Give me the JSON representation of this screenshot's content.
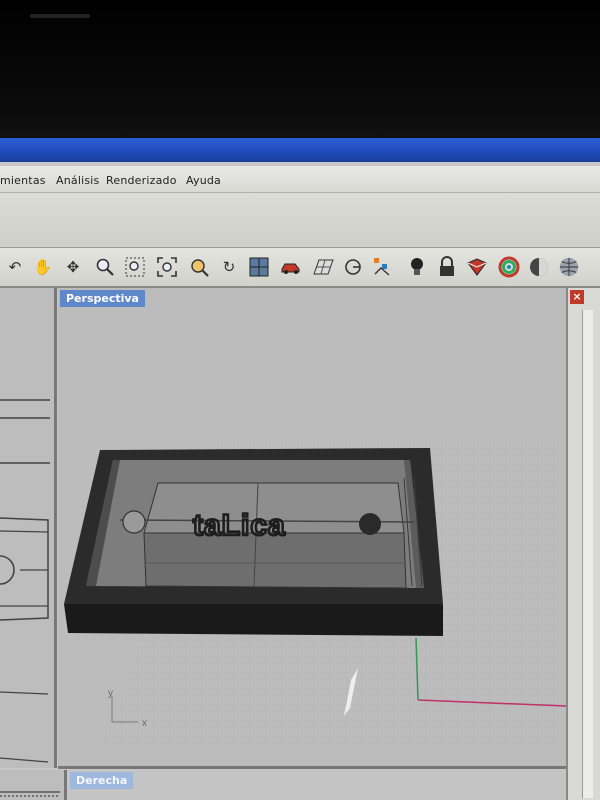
{
  "menu": {
    "items": [
      "mientas",
      "Análisis",
      "Renderizado",
      "Ayuda"
    ]
  },
  "toolbar": {
    "icons": [
      "undo-arrow-icon",
      "pan-hand-icon",
      "rotate-view-icon",
      "zoom-icon",
      "zoom-window-icon",
      "zoom-extents-icon",
      "zoom-selected-icon",
      "rotate-camera-icon",
      "four-viewports-icon",
      "car-icon",
      "grid-plane-icon",
      "cplane-icon",
      "osnap-icon",
      "light-bulb-icon",
      "lock-icon",
      "render-icon",
      "color-wheel-icon",
      "shaded-sphere-icon",
      "rendered-sphere-icon"
    ]
  },
  "viewports": {
    "perspective": {
      "label": "Perspectiva"
    },
    "right": {
      "label": "Derecha"
    }
  },
  "model": {
    "engraved_text": "taLica"
  },
  "axes": {
    "y": "y",
    "x": "x"
  },
  "right_panel": {
    "close_glyph": "×"
  },
  "colors": {
    "titlebar": "#1f49b8",
    "label_bg": "#5f87c9",
    "grid_x_axis": "#c0306a",
    "grid_y_axis": "#2f9a55"
  }
}
